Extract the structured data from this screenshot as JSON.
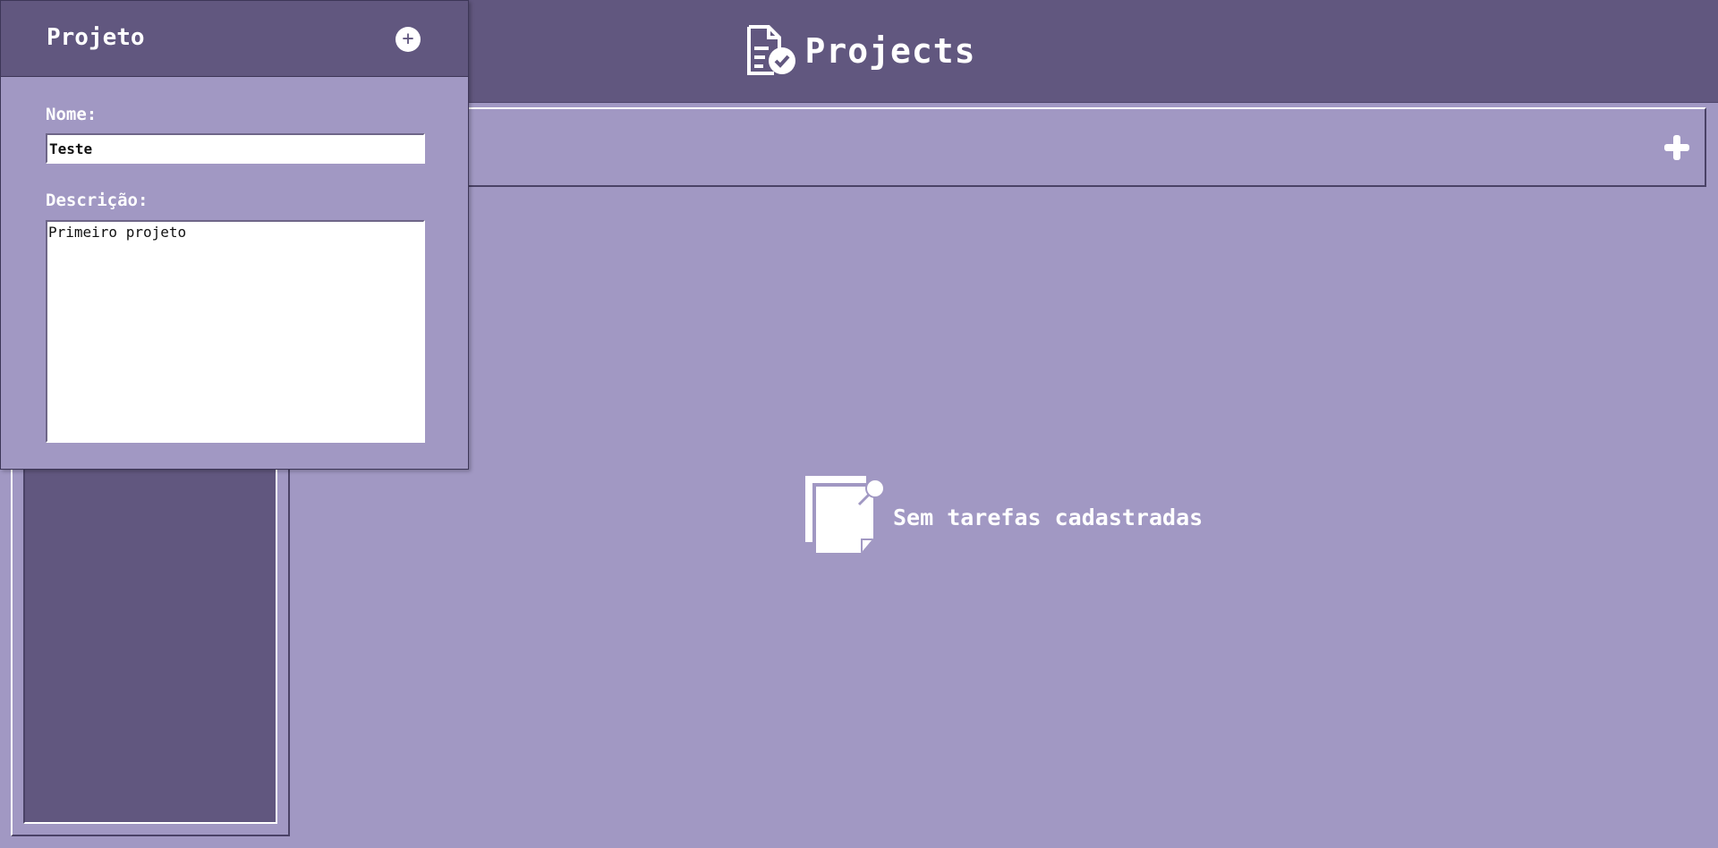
{
  "header": {
    "title": "Projects",
    "icon": "clipboard-check-icon"
  },
  "tasks": {
    "add_icon": "plus-icon",
    "empty_icon": "sticky-note-icon",
    "empty_text": "Sem tarefas cadastradas"
  },
  "project_panel": {
    "title": "Projeto",
    "add_icon": "plus-circle-icon",
    "name_label": "Nome:",
    "name_value": "Teste",
    "description_label": "Descrição:",
    "description_value": "Primeiro projeto"
  },
  "colors": {
    "header_bg": "#61577f",
    "page_bg": "#a198c3",
    "text": "#ffffff"
  }
}
